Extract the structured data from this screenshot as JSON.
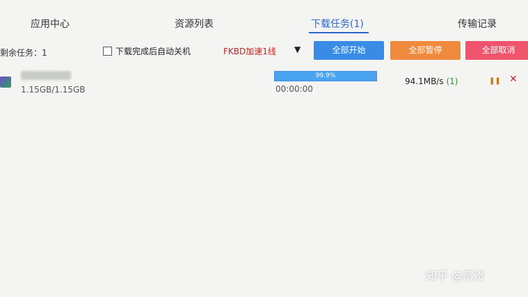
{
  "tabs": [
    {
      "label": "应用中心"
    },
    {
      "label": "资源列表"
    },
    {
      "label": "下载任务(1)"
    },
    {
      "label": "传输记录"
    }
  ],
  "toolbar": {
    "remaining_label": "剩余任务：1",
    "auto_shutdown_label": "下载完成后自动关机",
    "auto_shutdown_checked": false,
    "route_selected": "FKBD加速1线",
    "start_all_label": "全部开始",
    "pause_all_label": "全部暂停",
    "cancel_all_label": "全部取消"
  },
  "task": {
    "size": "1.15GB/1.15GB",
    "progress_text": "99.9%",
    "progress_value": 0.999,
    "time_elapsed": "00:00:00",
    "speed": "94.1MB/s",
    "connections": "(1)"
  },
  "watermark": "知乎 @富贵",
  "colors": {
    "accent": "#2a66c8",
    "start_button": "#3a8be5",
    "pause_button": "#f08a3e",
    "cancel_button": "#f0546c",
    "route_text": "#c81d1d"
  },
  "icons": [
    "file-icon",
    "chevron-down-icon",
    "pause-icon",
    "close-icon"
  ]
}
